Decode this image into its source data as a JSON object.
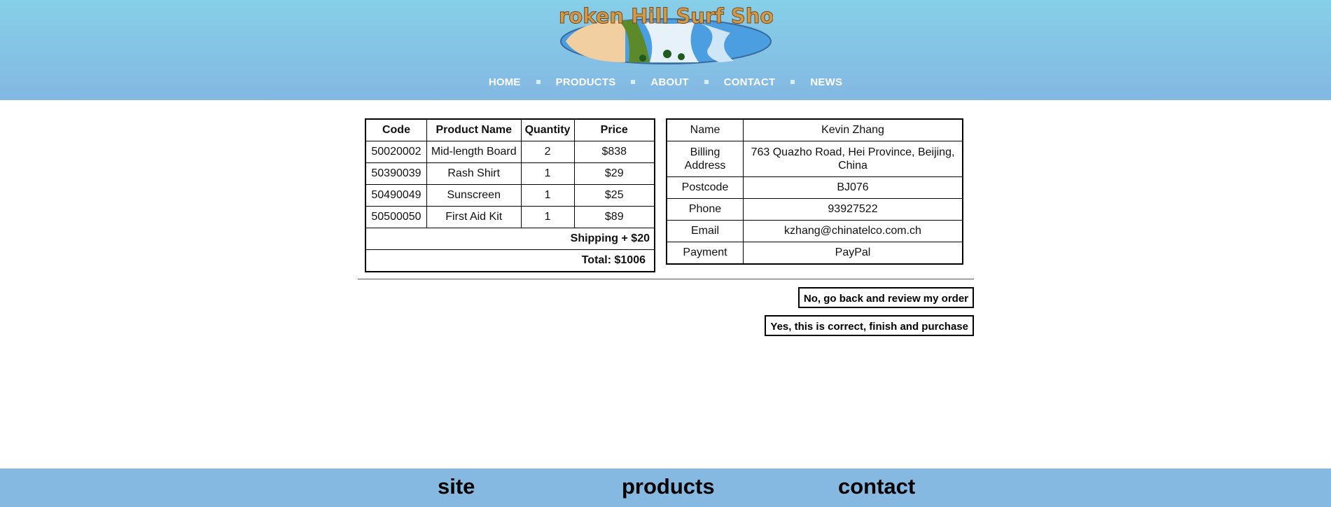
{
  "header": {
    "logo_text": "Broken Hill Surf Shop",
    "nav": [
      "HOME",
      "PRODUCTS",
      "ABOUT",
      "CONTACT",
      "NEWS"
    ]
  },
  "order": {
    "headers": [
      "Code",
      "Product Name",
      "Quantity",
      "Price"
    ],
    "rows": [
      [
        "50020002",
        "Mid-length Board",
        "2",
        "$838"
      ],
      [
        "50390039",
        "Rash Shirt",
        "1",
        "$29"
      ],
      [
        "50490049",
        "Sunscreen",
        "1",
        "$25"
      ],
      [
        "50500050",
        "First Aid Kit",
        "1",
        "$89"
      ]
    ],
    "shipping": "Shipping + $20",
    "total": "Total: $1006"
  },
  "customer": {
    "rows": [
      [
        "Name",
        "Kevin Zhang"
      ],
      [
        "Billing Address",
        "763 Quazho Road, Hei Province, Beijing, China"
      ],
      [
        "Postcode",
        "BJ076"
      ],
      [
        "Phone",
        "93927522"
      ],
      [
        "Email",
        "kzhang@chinatelco.com.ch"
      ],
      [
        "Payment",
        "PayPal"
      ]
    ]
  },
  "actions": {
    "back": "No, go back and review my order",
    "confirm": "Yes, this is correct, finish and purchase"
  },
  "footer": {
    "links": [
      "site",
      "products",
      "contact"
    ]
  },
  "colors": {
    "header_top": "#86cfe8",
    "header_bottom": "#83b8e2",
    "footer": "#86b9e2"
  }
}
